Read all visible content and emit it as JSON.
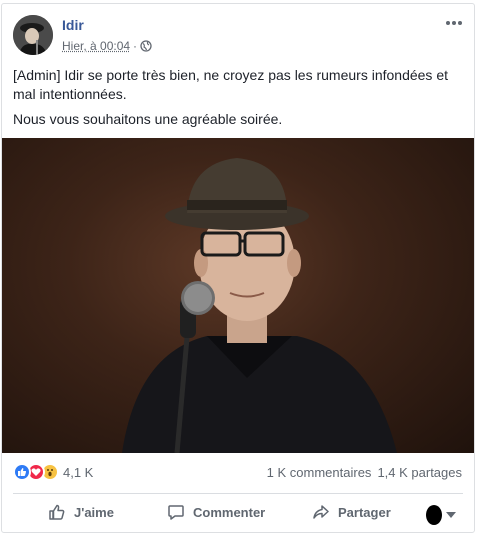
{
  "post": {
    "author": "Idir",
    "time": "Hier, à 00:04",
    "separator": "·",
    "text_line1": "[Admin] Idir se porte très bien, ne croyez pas les rumeurs infondées et mal intentionnées.",
    "text_line2": "Nous vous souhaitons une agréable soirée."
  },
  "reactions": {
    "count": "4,1 K",
    "comments": "1 K commentaires",
    "shares": "1,4 K partages"
  },
  "actions": {
    "like": "J'aime",
    "comment": "Commenter",
    "share": "Partager"
  },
  "icons": [
    "globe-icon",
    "more-options-icon",
    "like-icon",
    "comment-icon",
    "share-icon",
    "chevron-down-icon"
  ],
  "colors": {
    "author": "#385898",
    "meta": "#616770",
    "like_reaction": "#2f7bf5",
    "love_reaction": "#f0284a",
    "wow_reaction": "#f7c242"
  }
}
